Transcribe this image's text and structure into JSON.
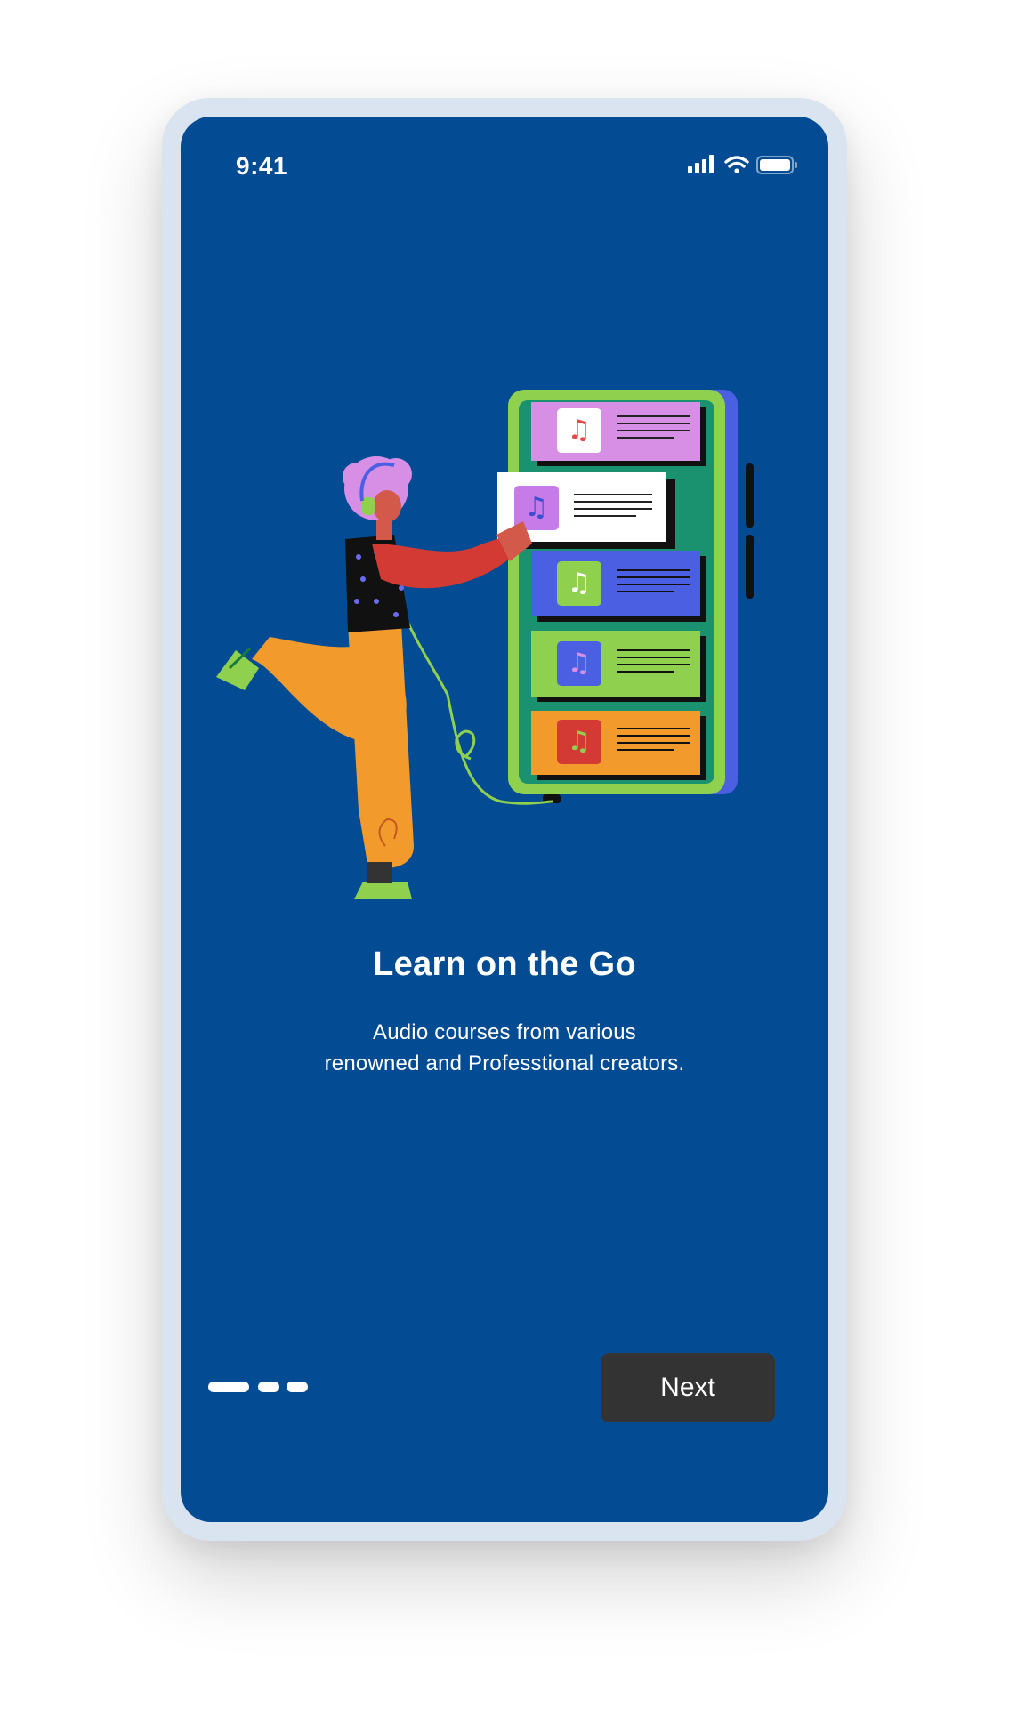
{
  "colors": {
    "screen_background": "#034c94",
    "button_background": "#333333",
    "text": "#ffffff",
    "frame": "#d9e4f0"
  },
  "status_bar": {
    "time": "9:41",
    "icons": [
      "signal-icon",
      "wifi-icon",
      "battery-icon"
    ]
  },
  "onboarding": {
    "title": "Learn on the Go",
    "subtitle_lines": [
      "Audio courses from various",
      "renowned and Professtional creators."
    ],
    "page_indicator": {
      "total": 3,
      "current": 1
    },
    "next_label": "Next"
  }
}
